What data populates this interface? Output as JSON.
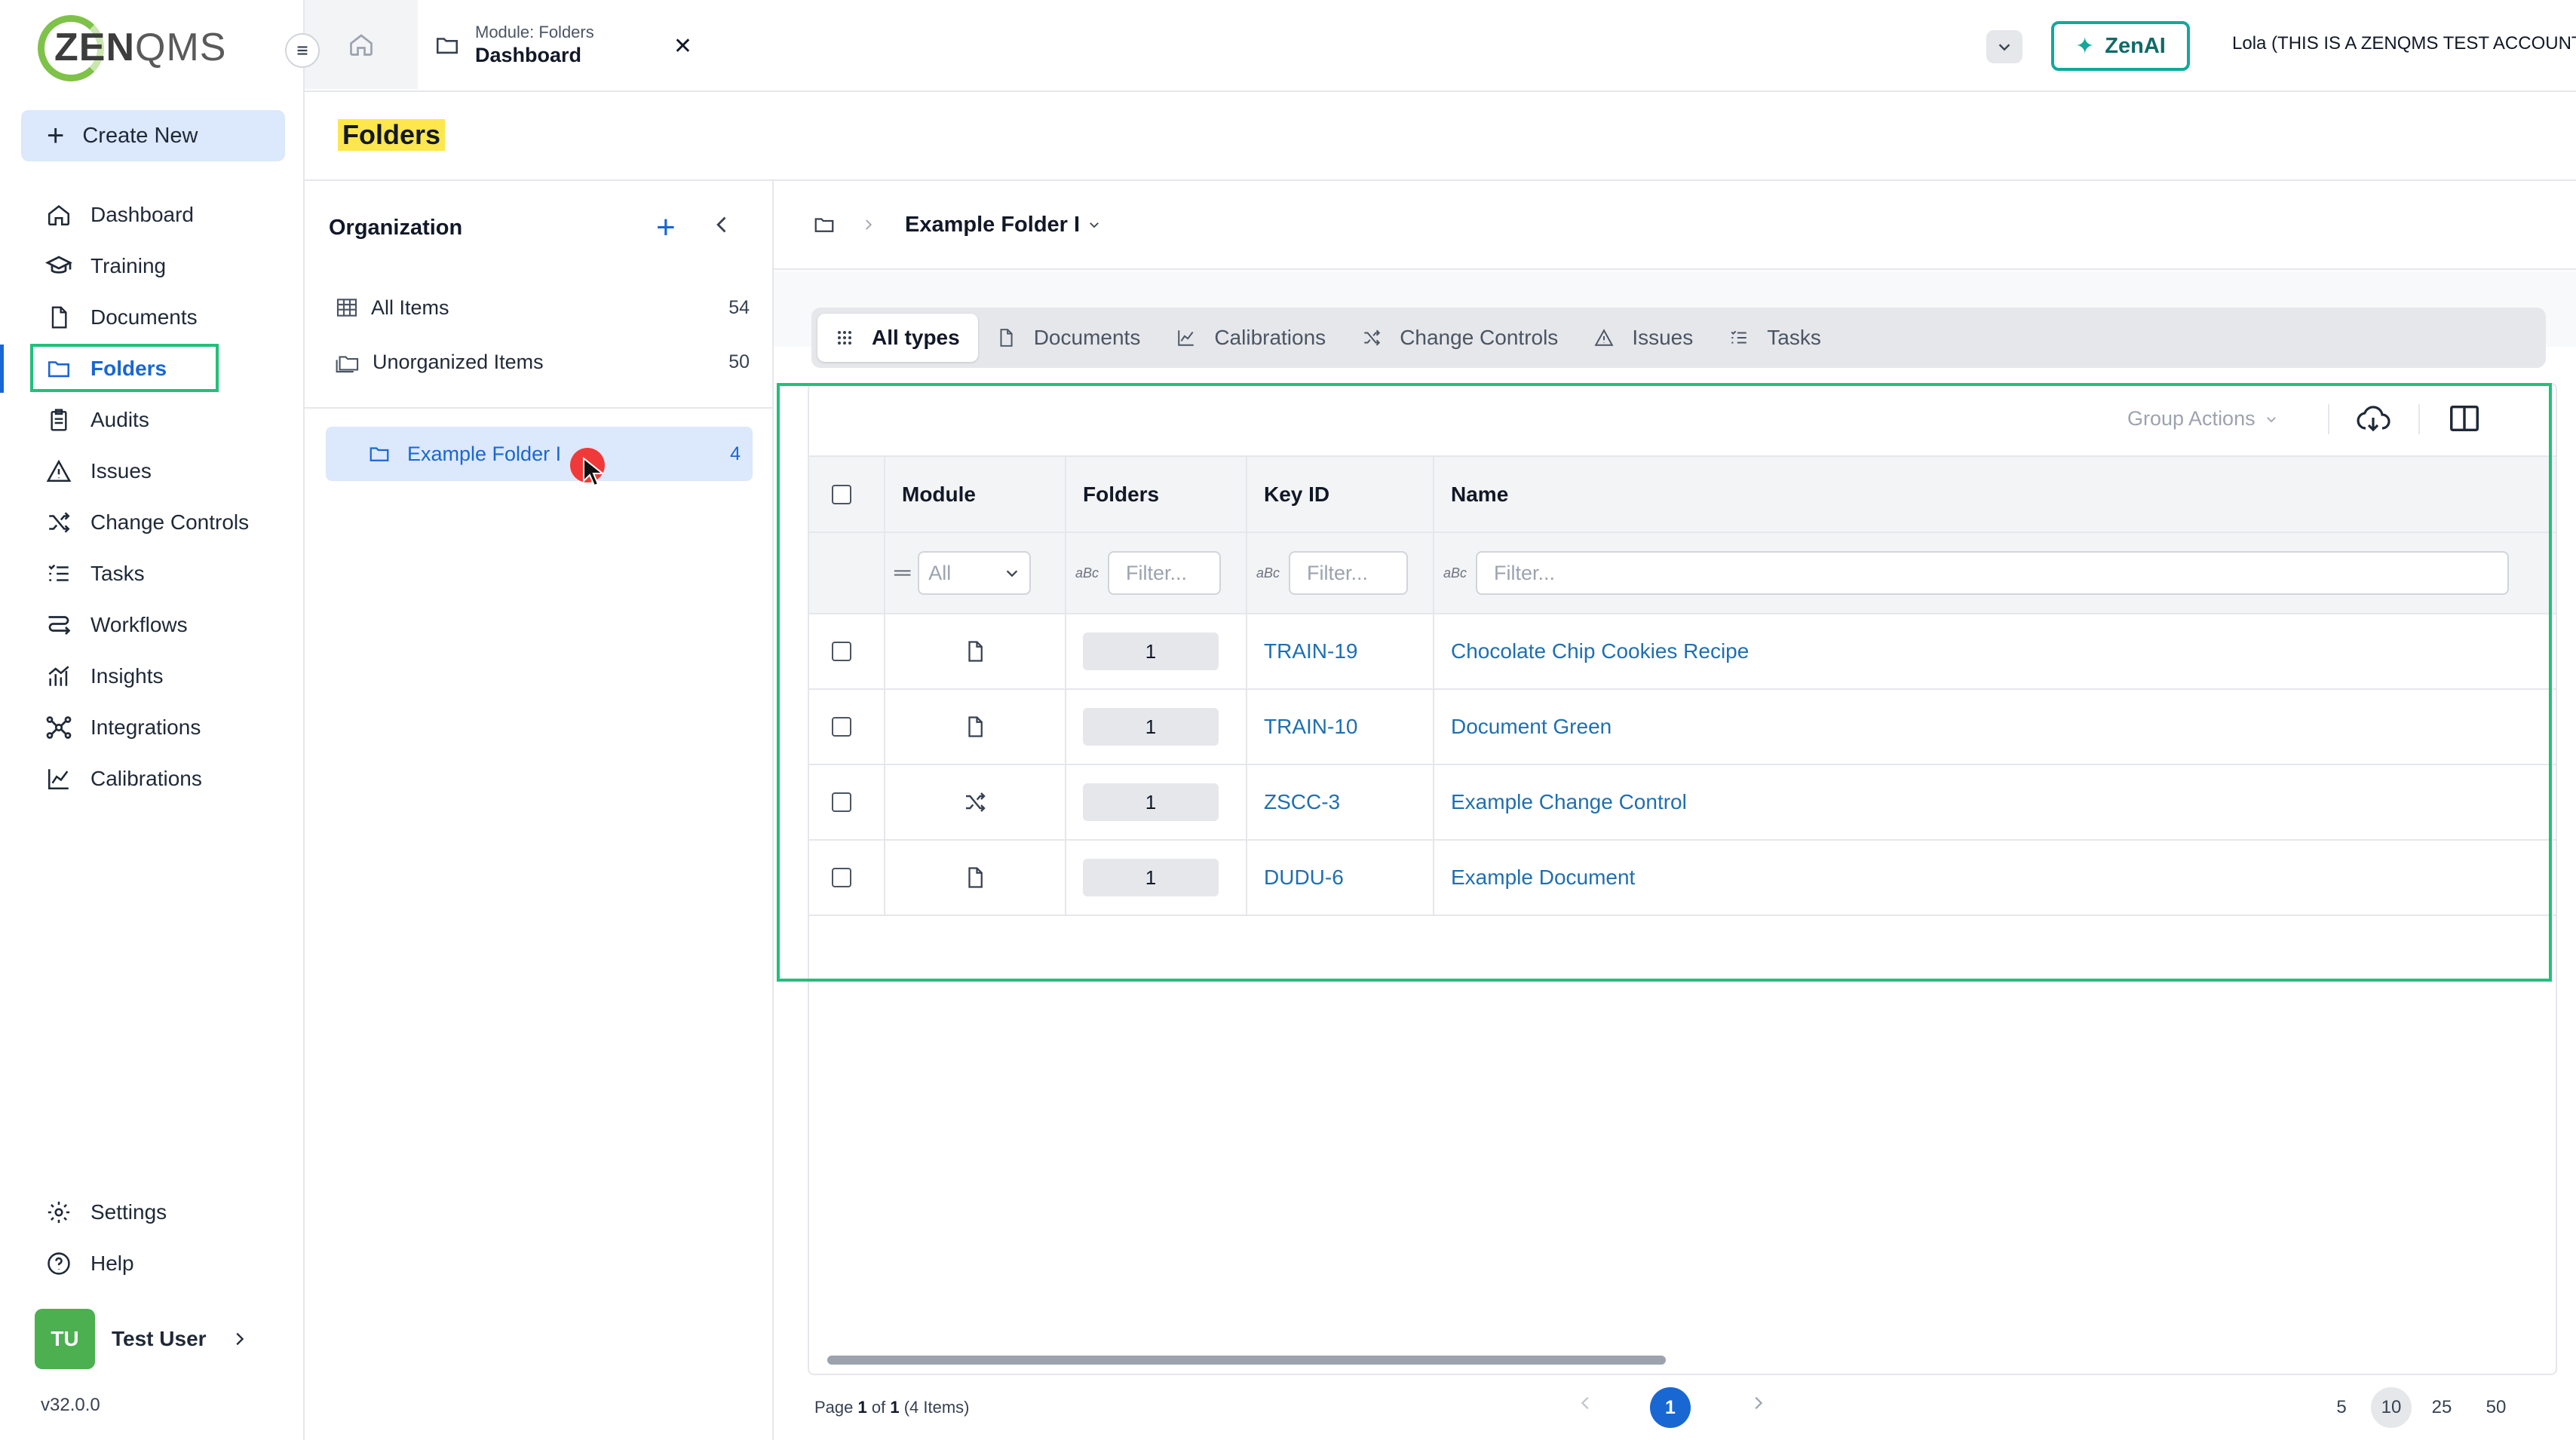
{
  "brand": {
    "logo_bold": "ZEN",
    "logo_light": "QMS"
  },
  "sidebar": {
    "create_new": "Create New",
    "items": [
      {
        "label": "Dashboard",
        "icon": "home-icon"
      },
      {
        "label": "Training",
        "icon": "graduation-cap-icon"
      },
      {
        "label": "Documents",
        "icon": "document-icon"
      },
      {
        "label": "Folders",
        "icon": "folder-icon",
        "active": true
      },
      {
        "label": "Audits",
        "icon": "clipboard-icon"
      },
      {
        "label": "Issues",
        "icon": "warning-icon"
      },
      {
        "label": "Change Controls",
        "icon": "shuffle-icon"
      },
      {
        "label": "Tasks",
        "icon": "checklist-icon"
      },
      {
        "label": "Workflows",
        "icon": "workflow-icon"
      },
      {
        "label": "Insights",
        "icon": "chart-icon"
      },
      {
        "label": "Integrations",
        "icon": "network-icon"
      },
      {
        "label": "Calibrations",
        "icon": "line-chart-icon"
      }
    ],
    "settings": "Settings",
    "help": "Help",
    "user": {
      "initials": "TU",
      "name": "Test User"
    },
    "version": "v32.0.0"
  },
  "topbar": {
    "tab_module": "Module: Folders",
    "tab_title": "Dashboard",
    "zenai": "ZenAI",
    "account": "Lola (THIS IS A ZENQMS TEST ACCOUNT)"
  },
  "page": {
    "title": "Folders"
  },
  "organization": {
    "title": "Organization",
    "all_items": {
      "label": "All Items",
      "count": "54"
    },
    "unorganized": {
      "label": "Unorganized Items",
      "count": "50"
    },
    "folder": {
      "label": "Example Folder I",
      "count": "4"
    }
  },
  "main": {
    "breadcrumb_folder": "Example Folder I",
    "type_tabs": [
      {
        "label": "All types",
        "icon": "grid-icon",
        "active": true
      },
      {
        "label": "Documents",
        "icon": "document-icon"
      },
      {
        "label": "Calibrations",
        "icon": "line-chart-icon"
      },
      {
        "label": "Change Controls",
        "icon": "shuffle-icon"
      },
      {
        "label": "Issues",
        "icon": "warning-icon"
      },
      {
        "label": "Tasks",
        "icon": "checklist-icon"
      }
    ],
    "group_actions": "Group Actions",
    "columns": {
      "module": "Module",
      "folders": "Folders",
      "key_id": "Key ID",
      "name": "Name"
    },
    "filters": {
      "module_select": "All",
      "placeholder": "Filter...",
      "text_icon": "aBc"
    },
    "rows": [
      {
        "module_icon": "document-icon",
        "folders": "1",
        "key_id": "TRAIN-19",
        "name": "Chocolate Chip Cookies Recipe"
      },
      {
        "module_icon": "document-icon",
        "folders": "1",
        "key_id": "TRAIN-10",
        "name": "Document Green"
      },
      {
        "module_icon": "shuffle-icon",
        "folders": "1",
        "key_id": "ZSCC-3",
        "name": "Example Change Control"
      },
      {
        "module_icon": "document-icon",
        "folders": "1",
        "key_id": "DUDU-6",
        "name": "Example Document"
      }
    ],
    "pager": {
      "page_prefix": "Page ",
      "page": "1",
      "of": " of ",
      "total_pages": "1",
      "items": " (4 Items)",
      "current": "1",
      "sizes": [
        "5",
        "10",
        "25",
        "50"
      ],
      "selected_size": "10"
    }
  },
  "colors": {
    "accent": "#1967d2",
    "highlight": "#22c07a",
    "zenai": "#12a89b",
    "title_marker": "#fde74c"
  }
}
